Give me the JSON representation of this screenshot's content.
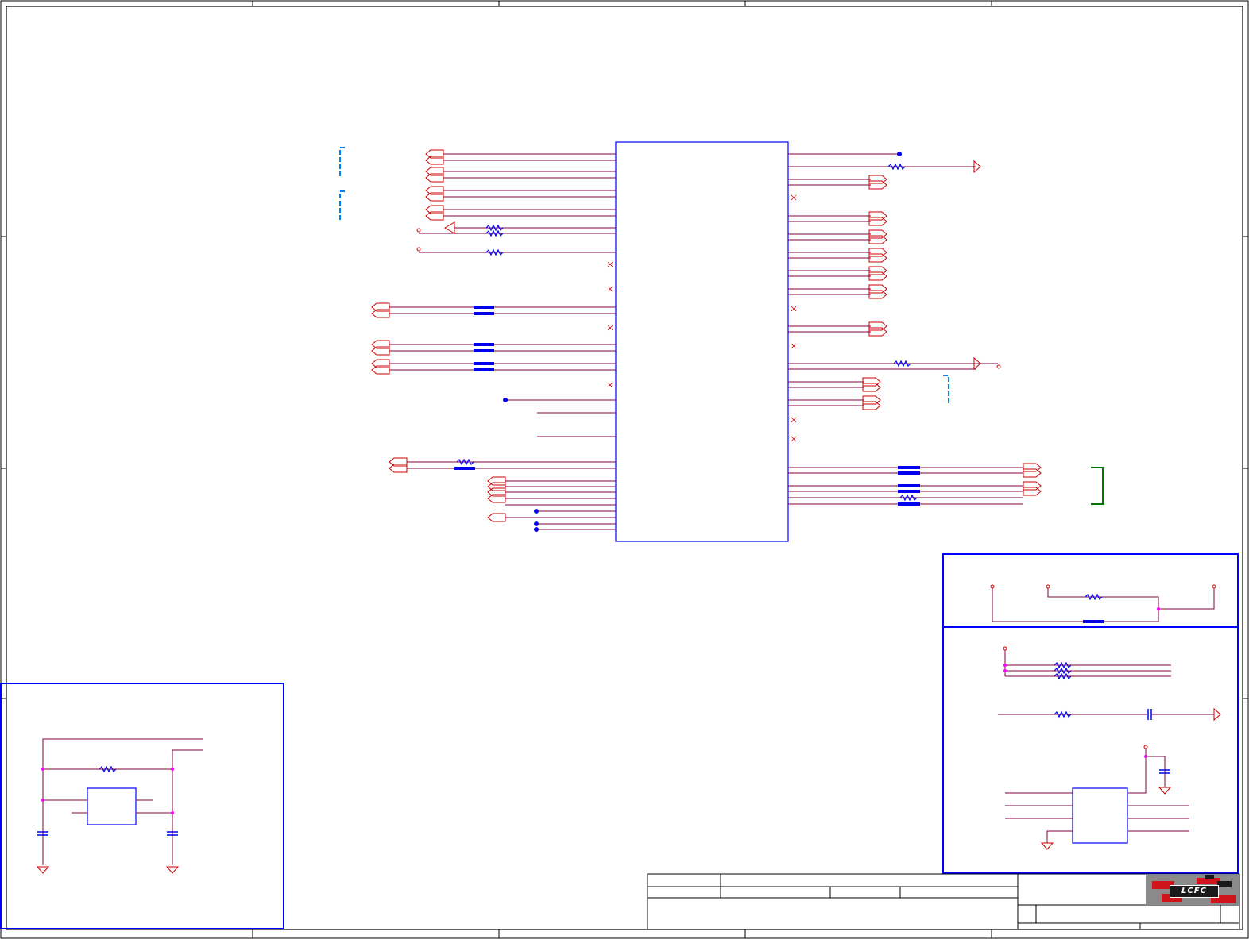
{
  "logo": {
    "text": "LCFC"
  },
  "colors": {
    "wire": "#cc0000",
    "net": "#800040",
    "frame": "#0000ff",
    "bus": "#0000ee",
    "dashed": "#0080ff",
    "bracket": "#007700",
    "junction": "#ff00ff",
    "border": "#000000"
  }
}
